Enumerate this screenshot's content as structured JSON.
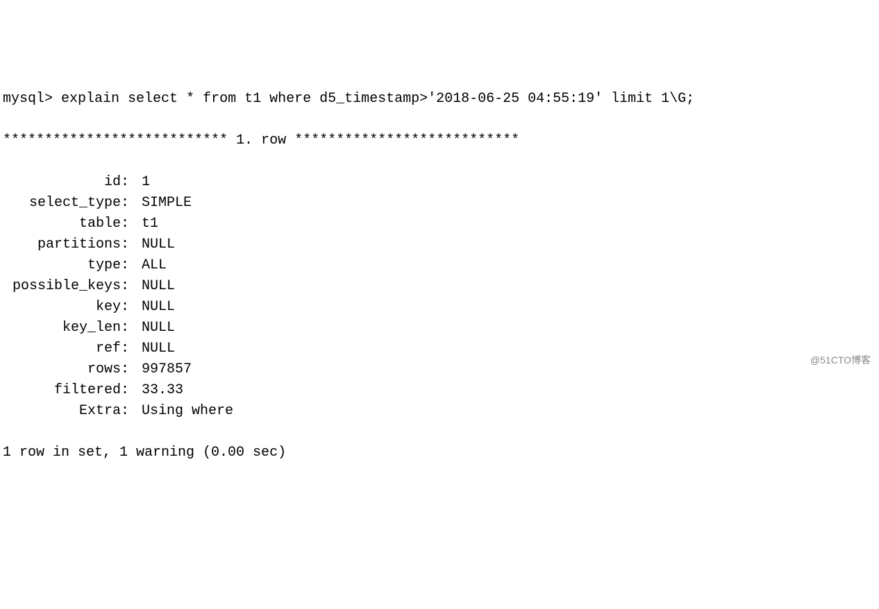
{
  "terminal": {
    "prompt": "mysql>",
    "command": "explain select * from t1 where d5_timestamp>'2018-06-25 04:55:19' limit 1\\G;",
    "row_header": "*************************** 1. row ***************************",
    "fields": [
      {
        "label": "id",
        "value": "1"
      },
      {
        "label": "select_type",
        "value": "SIMPLE"
      },
      {
        "label": "table",
        "value": "t1"
      },
      {
        "label": "partitions",
        "value": "NULL"
      },
      {
        "label": "type",
        "value": "ALL"
      },
      {
        "label": "possible_keys",
        "value": "NULL"
      },
      {
        "label": "key",
        "value": "NULL"
      },
      {
        "label": "key_len",
        "value": "NULL"
      },
      {
        "label": "ref",
        "value": "NULL"
      },
      {
        "label": "rows",
        "value": "997857"
      },
      {
        "label": "filtered",
        "value": "33.33"
      },
      {
        "label": "Extra",
        "value": "Using where"
      }
    ],
    "footer": "1 row in set, 1 warning (0.00 sec)"
  },
  "watermark": "@51CTO博客"
}
